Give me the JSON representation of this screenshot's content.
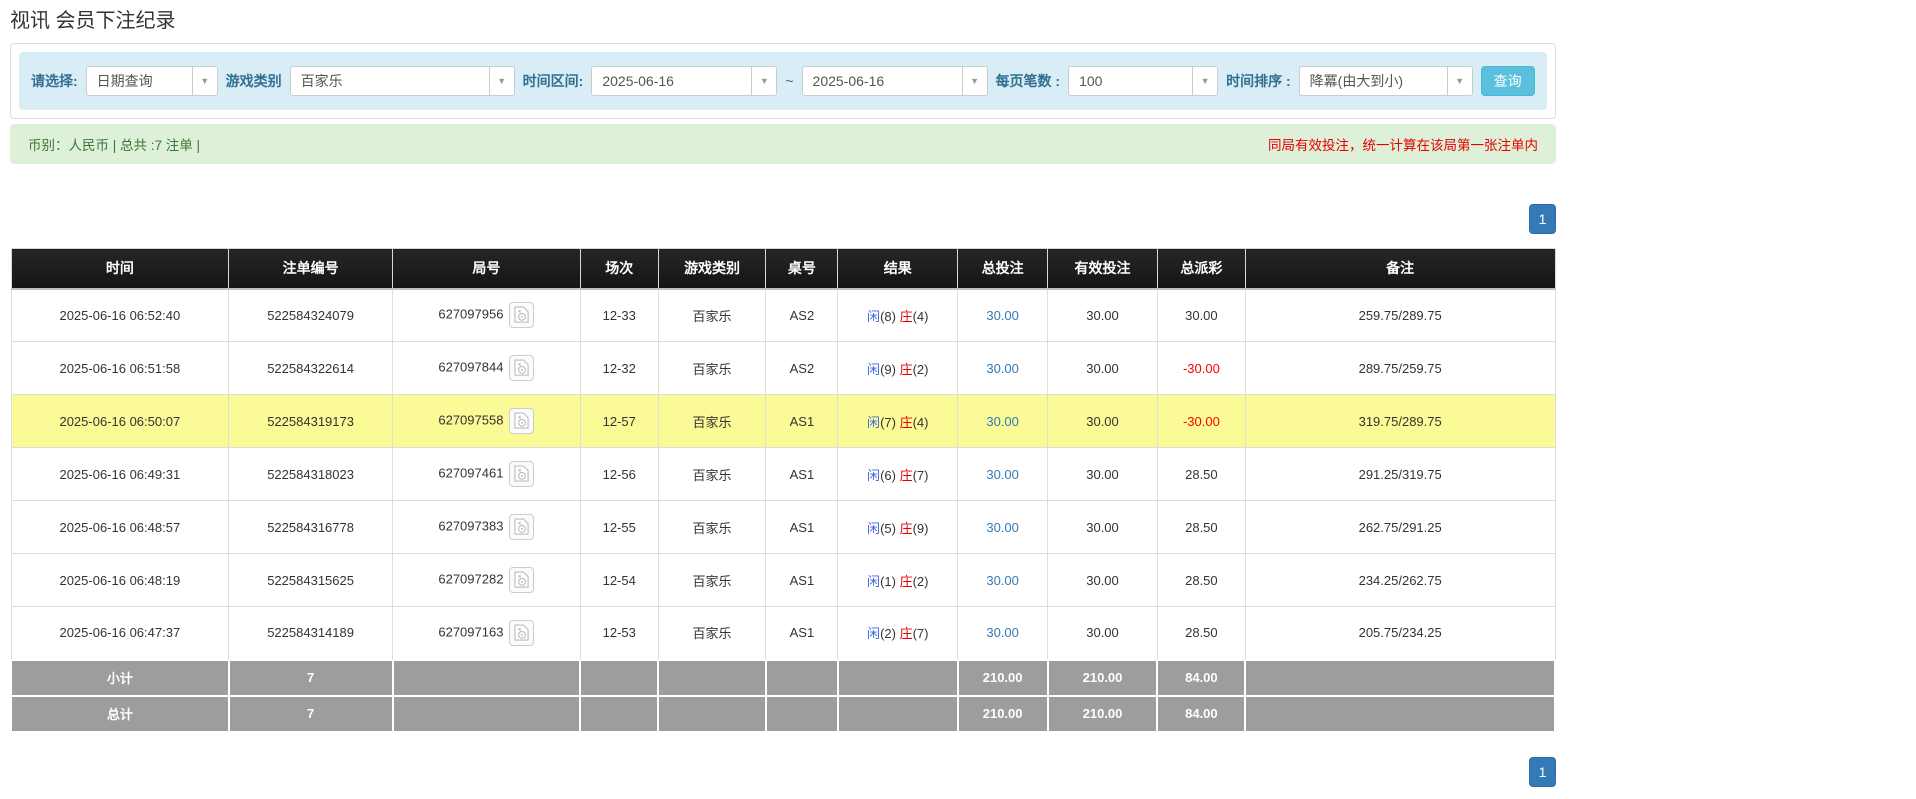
{
  "page": {
    "title": "视讯 会员下注纪录"
  },
  "filterbar": {
    "select_label": "请选择:",
    "select_value": "日期查询",
    "game_label": "游戏类别",
    "game_value": "百家乐",
    "range_label": "时间区间:",
    "date_from": "2025-06-16",
    "range_separator": "~",
    "date_to": "2025-06-16",
    "page_size_label": "每页笔数 :",
    "page_size_value": "100",
    "sort_label": "时间排序 :",
    "sort_value": "降冪(由大到小)",
    "search_label": "查询"
  },
  "summary_bar": {
    "left_text": "币别：人民币 | 总共 :7 注单 |",
    "right_notice": "同局有效投注，统一计算在该局第一张注单内"
  },
  "pagination": {
    "current_page": "1"
  },
  "icons": {
    "dropdown_arrow": "▼",
    "video_icon": "video-record-icon"
  },
  "colors": {
    "filter_bg": "#d9edf7",
    "filter_label": "#31708f",
    "search_btn": "#5bc0de",
    "summary_bg": "#dff0d8",
    "summary_text": "#3c763d",
    "notice_red": "#e60000",
    "header_bg": "#1b1b1b",
    "footer_bg": "#9d9d9d",
    "highlight_row": "#fafa96",
    "link_blue": "#337ab7",
    "player_blue": "#4169e1",
    "banker_red": "#e60000",
    "negative_red": "#ff0000",
    "pager_blue": "#337ab7"
  },
  "table": {
    "headers": [
      "时间",
      "注单编号",
      "局号",
      "场次",
      "游戏类别",
      "桌号",
      "结果",
      "总投注",
      "有效投注",
      "总派彩",
      "备注"
    ],
    "rows": [
      {
        "time": "2025-06-16 06:52:40",
        "bet_no": "522584324079",
        "round_no": "627097956",
        "session": "12-33",
        "game": "百家乐",
        "table_no": "AS2",
        "result_player": "闲",
        "result_player_num": "(8)",
        "result_banker": "庄",
        "result_banker_num": "(4)",
        "total_bet": "30.00",
        "valid_bet": "30.00",
        "payout": "30.00",
        "payout_negative": false,
        "note": "259.75/289.75",
        "highlighted": false
      },
      {
        "time": "2025-06-16 06:51:58",
        "bet_no": "522584322614",
        "round_no": "627097844",
        "session": "12-32",
        "game": "百家乐",
        "table_no": "AS2",
        "result_player": "闲",
        "result_player_num": "(9)",
        "result_banker": "庄",
        "result_banker_num": "(2)",
        "total_bet": "30.00",
        "valid_bet": "30.00",
        "payout": "-30.00",
        "payout_negative": true,
        "note": "289.75/259.75",
        "highlighted": false
      },
      {
        "time": "2025-06-16 06:50:07",
        "bet_no": "522584319173",
        "round_no": "627097558",
        "session": "12-57",
        "game": "百家乐",
        "table_no": "AS1",
        "result_player": "闲",
        "result_player_num": "(7)",
        "result_banker": "庄",
        "result_banker_num": "(4)",
        "total_bet": "30.00",
        "valid_bet": "30.00",
        "payout": "-30.00",
        "payout_negative": true,
        "note": "319.75/289.75",
        "highlighted": true
      },
      {
        "time": "2025-06-16 06:49:31",
        "bet_no": "522584318023",
        "round_no": "627097461",
        "session": "12-56",
        "game": "百家乐",
        "table_no": "AS1",
        "result_player": "闲",
        "result_player_num": "(6)",
        "result_banker": "庄",
        "result_banker_num": "(7)",
        "total_bet": "30.00",
        "valid_bet": "30.00",
        "payout": "28.50",
        "payout_negative": false,
        "note": "291.25/319.75",
        "highlighted": false
      },
      {
        "time": "2025-06-16 06:48:57",
        "bet_no": "522584316778",
        "round_no": "627097383",
        "session": "12-55",
        "game": "百家乐",
        "table_no": "AS1",
        "result_player": "闲",
        "result_player_num": "(5)",
        "result_banker": "庄",
        "result_banker_num": "(9)",
        "total_bet": "30.00",
        "valid_bet": "30.00",
        "payout": "28.50",
        "payout_negative": false,
        "note": "262.75/291.25",
        "highlighted": false
      },
      {
        "time": "2025-06-16 06:48:19",
        "bet_no": "522584315625",
        "round_no": "627097282",
        "session": "12-54",
        "game": "百家乐",
        "table_no": "AS1",
        "result_player": "闲",
        "result_player_num": "(1)",
        "result_banker": "庄",
        "result_banker_num": "(2)",
        "total_bet": "30.00",
        "valid_bet": "30.00",
        "payout": "28.50",
        "payout_negative": false,
        "note": "234.25/262.75",
        "highlighted": false
      },
      {
        "time": "2025-06-16 06:47:37",
        "bet_no": "522584314189",
        "round_no": "627097163",
        "session": "12-53",
        "game": "百家乐",
        "table_no": "AS1",
        "result_player": "闲",
        "result_player_num": "(2)",
        "result_banker": "庄",
        "result_banker_num": "(7)",
        "total_bet": "30.00",
        "valid_bet": "30.00",
        "payout": "28.50",
        "payout_negative": false,
        "note": "205.75/234.25",
        "highlighted": false
      }
    ],
    "footer_rows": [
      {
        "label": "小计",
        "count": "7",
        "total_bet": "210.00",
        "valid_bet": "210.00",
        "payout": "84.00"
      },
      {
        "label": "总计",
        "count": "7",
        "total_bet": "210.00",
        "valid_bet": "210.00",
        "payout": "84.00"
      }
    ]
  }
}
